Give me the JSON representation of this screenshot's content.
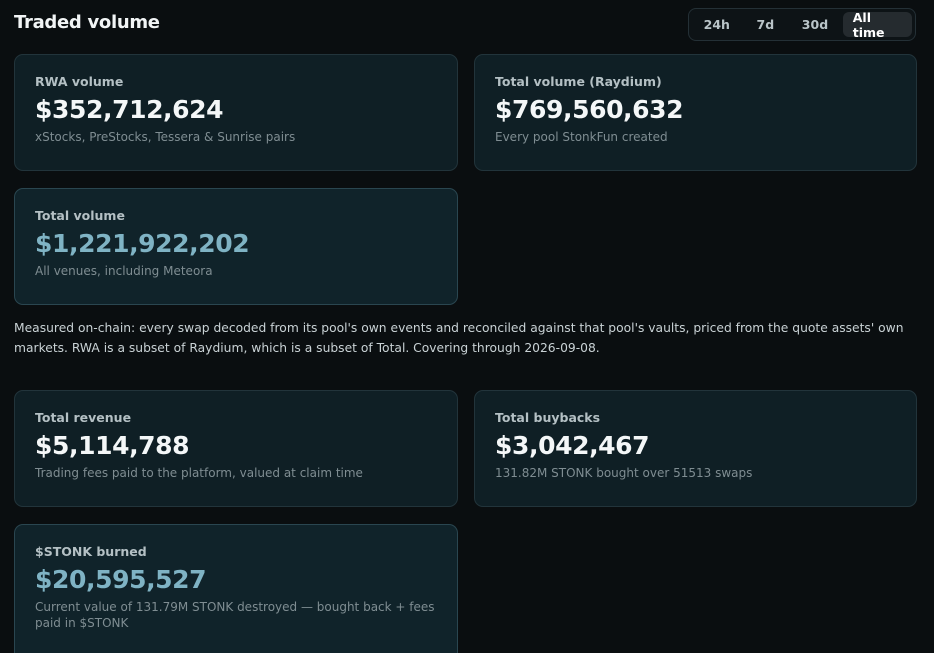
{
  "header": {
    "title": "Traded volume"
  },
  "time_range": {
    "options": [
      "24h",
      "7d",
      "30d",
      "All time"
    ],
    "selected": "All time"
  },
  "cards": {
    "rwa_volume": {
      "label": "RWA volume",
      "value": "$352,712,624",
      "sub": "xStocks, PreStocks, Tessera & Sunrise pairs"
    },
    "raydium_volume": {
      "label": "Total volume (Raydium)",
      "value": "$769,560,632",
      "sub": "Every pool StonkFun created"
    },
    "total_volume": {
      "label": "Total volume",
      "value": "$1,221,922,202",
      "sub": "All venues, including Meteora"
    },
    "total_revenue": {
      "label": "Total revenue",
      "value": "$5,114,788",
      "sub": "Trading fees paid to the platform, valued at claim time"
    },
    "total_buybacks": {
      "label": "Total buybacks",
      "value": "$3,042,467",
      "sub": "131.82M STONK bought over 51513 swaps"
    },
    "stonk_burned": {
      "label": "$STONK burned",
      "value": "$20,595,527",
      "sub": "Current value of 131.79M STONK destroyed — bought back + fees paid in $STONK"
    }
  },
  "note": "Measured on-chain: every swap decoded from its pool's own events and reconciled against that pool's vaults, priced from the quote assets' own markets. RWA is a subset of Raydium, which is a subset of Total. Covering through 2026-09-08.",
  "colors": {
    "background": "#0a0e10",
    "card": "#0f1f25",
    "highlight_value": "#7fb3c4"
  }
}
